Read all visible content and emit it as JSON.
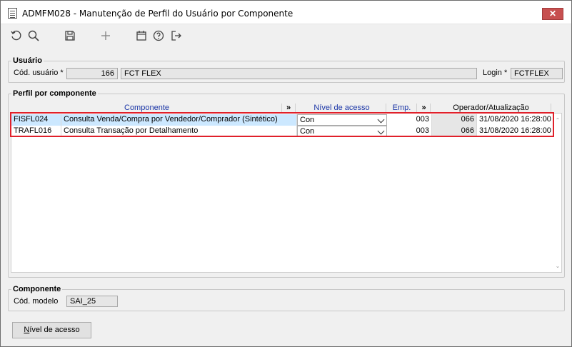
{
  "window": {
    "title": "ADMFM028 - Manutenção de Perfil do Usuário por Componente",
    "close_glyph": "✕"
  },
  "toolbar": {
    "icons": [
      "refresh-icon",
      "search-icon",
      "save-icon",
      "add-icon",
      "calendar-icon",
      "help-icon",
      "exit-icon"
    ]
  },
  "usuario": {
    "legend": "Usuário",
    "cod_label": "Cód. usuário *",
    "cod_value": "166",
    "name_value": "FCT FLEX",
    "login_label": "Login *",
    "login_value": "FCTFLEX"
  },
  "perfil": {
    "legend": "Perfil por componente",
    "headers": {
      "componente": "Componente",
      "expand1": "»",
      "nivel": "Nível de acesso",
      "emp": "Emp.",
      "expand2": "»",
      "operador": "Operador/Atualização"
    },
    "rows": [
      {
        "code": "FISFL024",
        "description": "Consulta Venda/Compra por Vendedor/Comprador (Sintético)",
        "nivel": "Con",
        "emp": "003",
        "operador": "066",
        "atualizacao": "31/08/2020 16:28:00"
      },
      {
        "code": "TRAFL016",
        "description": "Consulta Transação por Detalhamento",
        "nivel": "Con",
        "emp": "003",
        "operador": "066",
        "atualizacao": "31/08/2020 16:28:00"
      }
    ],
    "scroll_up": "⌃",
    "scroll_down": "⌄"
  },
  "componente": {
    "legend": "Componente",
    "modelo_label": "Cód. modelo",
    "modelo_value": "SAI_25"
  },
  "buttons": {
    "nivel_acesso_first": "N",
    "nivel_acesso_rest": "ível de acesso"
  },
  "colors": {
    "selection": "#cce8ff",
    "highlight_border": "#e0202a",
    "header_link": "#1a35a6",
    "close_button": "#c75050"
  }
}
